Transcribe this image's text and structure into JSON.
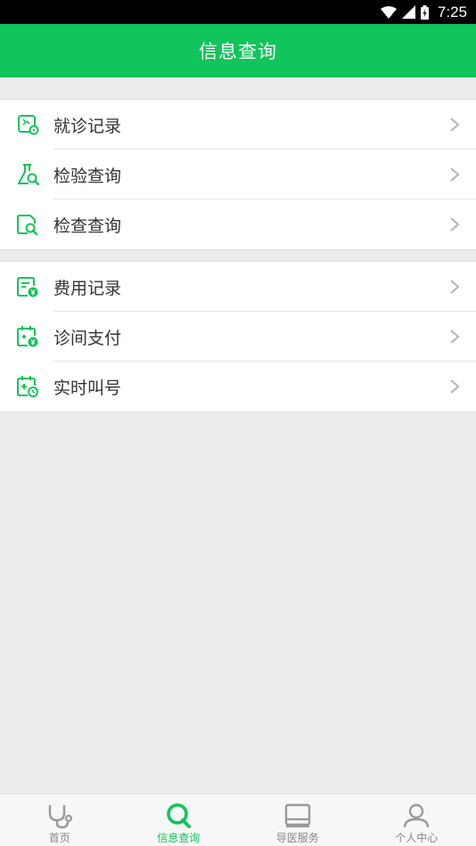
{
  "status_bar": {
    "time": "7:25"
  },
  "header": {
    "title": "信息查询"
  },
  "group1": [
    {
      "label": "就诊记录",
      "icon": "visit-record-icon"
    },
    {
      "label": "检验查询",
      "icon": "flask-search-icon"
    },
    {
      "label": "检查查询",
      "icon": "doc-search-icon"
    }
  ],
  "group2": [
    {
      "label": "费用记录",
      "icon": "fee-record-icon"
    },
    {
      "label": "诊间支付",
      "icon": "clinic-pay-icon"
    },
    {
      "label": "实时叫号",
      "icon": "realtime-queue-icon"
    }
  ],
  "tabbar": [
    {
      "label": "首页",
      "icon": "stethoscope-icon"
    },
    {
      "label": "信息查询",
      "icon": "search-icon"
    },
    {
      "label": "导医服务",
      "icon": "guide-service-icon"
    },
    {
      "label": "个人中心",
      "icon": "person-icon"
    }
  ],
  "colors": {
    "accent": "#11c45b",
    "tab_inactive": "#999999",
    "background": "#ececec"
  }
}
